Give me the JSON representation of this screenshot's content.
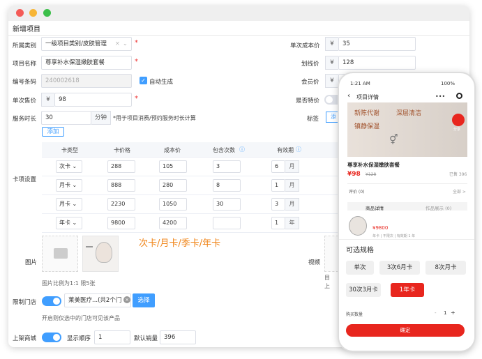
{
  "window": {
    "title": "新增项目"
  },
  "form": {
    "category_label": "所属类别",
    "category_value": "一级项目类别/皮肤管理",
    "name_label": "项目名称",
    "name_value": "尊享补水保湿嫩肤套餐",
    "barcode_label": "编号条码",
    "barcode_value": "240002618",
    "auto_label": "自动生成",
    "price_label": "单次售价",
    "price_prefix": "¥",
    "price_value": "98",
    "duration_label": "服务时长",
    "duration_value": "30",
    "duration_unit": "分钟",
    "duration_hint": "*用于项目消费/预约服务时长计算",
    "cost_label": "单次成本价",
    "cost_prefix": "¥",
    "cost_value": "35",
    "orig_label": "划线价",
    "orig_prefix": "¥",
    "orig_value": "128",
    "member_label": "会员价",
    "member_prefix": "¥",
    "special_label": "是否特价",
    "tag_label": "标签",
    "tag_value": "添",
    "card_label": "卡项设置",
    "add_label": "添加",
    "image_label": "图片",
    "image_hint": "图片比例为1:1 限5张",
    "video_label": "视频",
    "video_hint1": "目",
    "video_hint2": "上",
    "store_label": "限制门店",
    "store_value": "莱美医疗...(共2个门",
    "store_btn": "选择",
    "store_hint": "开启则仅选中的门店可见该产品",
    "shelf_label": "上架商城",
    "order_label": "显示顺序",
    "order_value": "1",
    "sales_label": "默认销量",
    "sales_value": "396"
  },
  "table": {
    "headers": [
      "卡类型",
      "卡价格",
      "成本价",
      "包含次数",
      "有效期"
    ],
    "rows": [
      {
        "type": "次卡",
        "price": "288",
        "cost": "105",
        "count": "3",
        "valid": "6",
        "unit": "月"
      },
      {
        "type": "月卡",
        "price": "888",
        "cost": "280",
        "count": "8",
        "valid": "1",
        "unit": "月"
      },
      {
        "type": "月卡",
        "price": "2230",
        "cost": "1050",
        "count": "30",
        "valid": "3",
        "unit": "月"
      },
      {
        "type": "年卡",
        "price": "9800",
        "cost": "4200",
        "count": "",
        "valid": "1",
        "unit": "年"
      }
    ]
  },
  "annotation": "次卡/月卡/季卡/年卡",
  "phone": {
    "time": "1:21 AM",
    "battery": "100%",
    "header": "项目详情",
    "banner_text1": "新陈代谢",
    "banner_text2": "深层清洁",
    "banner_text3": "镇静保湿",
    "share": "分享",
    "product_name": "尊享补水保湿嫩肤套餐",
    "price": "¥98",
    "orig_price": "¥128",
    "sold": "已售 396",
    "review_label": "评价 (0)",
    "review_all": "全部 >",
    "tab1": "商品详情",
    "tab2": "作品展示 (0)",
    "item_price": "¥9800",
    "item_meta": "年卡 | 不限次 | 有效期 1 年",
    "sheet_title": "可选规格",
    "specs": [
      "单次",
      "3次6月卡",
      "8次月卡",
      "30次3月卡",
      "1年卡"
    ],
    "qty_label": "购买数量",
    "qty_value": "1",
    "confirm": "确定"
  },
  "colors": {
    "accent": "#409eff",
    "phone_red": "#e8261e",
    "annotation": "#f08519"
  }
}
